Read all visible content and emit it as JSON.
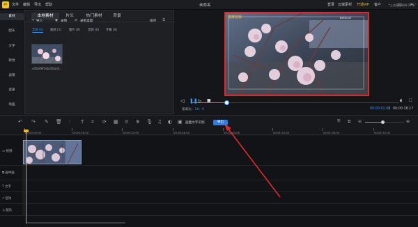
{
  "titlebar": {
    "app_logo": "logo-icon",
    "menus": [
      "文件",
      "编辑",
      "导出",
      "帮助"
    ],
    "title": "未命名",
    "right": {
      "login": "登录",
      "cloud": "云端素材",
      "vip": "开通VIP",
      "customer": "客户"
    },
    "window_buttons": [
      "minimize-icon",
      "maximize-icon",
      "close-icon"
    ]
  },
  "leftnav": {
    "items": [
      "素材",
      "配乐",
      "文字",
      "转场",
      "滤镜",
      "遮罩",
      "动画"
    ]
  },
  "media": {
    "tabs": [
      "本地素材",
      "片头",
      "热门素材",
      "背景"
    ],
    "import": "导入",
    "record": "录制",
    "screen_record": "录制桌面",
    "sort": "排序",
    "filters": [
      "全部 (1)",
      "视频 (1)",
      "图片 (0)",
      "音频 (0)",
      "字幕 (0)"
    ],
    "file_name": "e05b09f5db356a34..."
  },
  "preview": {
    "autosave": "上次保存时间 09:47",
    "watermark": "蜜蜂剪辑",
    "watermark_sub": "BEESCUT",
    "ratio_label": "宽高比：",
    "ratio_value": "16：9",
    "time_current": "00:00:01.08",
    "time_sep": "/",
    "time_total": "00:00:18.17",
    "progress": 0.17
  },
  "toolbar": {
    "text_label": "画面文字识别",
    "export_label": "导出",
    "zoom_level": 0.45
  },
  "ruler": {
    "ticks": [
      "00:00:00.00",
      "00:00:16.00",
      "00:00:32.00",
      "00:00:48.00",
      "00:01:04.00",
      "00:01:20.00",
      "00:01:36.00",
      "00:01:52.00"
    ]
  },
  "tracks": [
    "视频",
    "画中画",
    "文字",
    "音效",
    "配乐"
  ],
  "colors": {
    "accent": "#3d93ff",
    "highlight_border": "#e0292f",
    "export": "#2f7ee8",
    "playhead": "#f3b81e"
  }
}
